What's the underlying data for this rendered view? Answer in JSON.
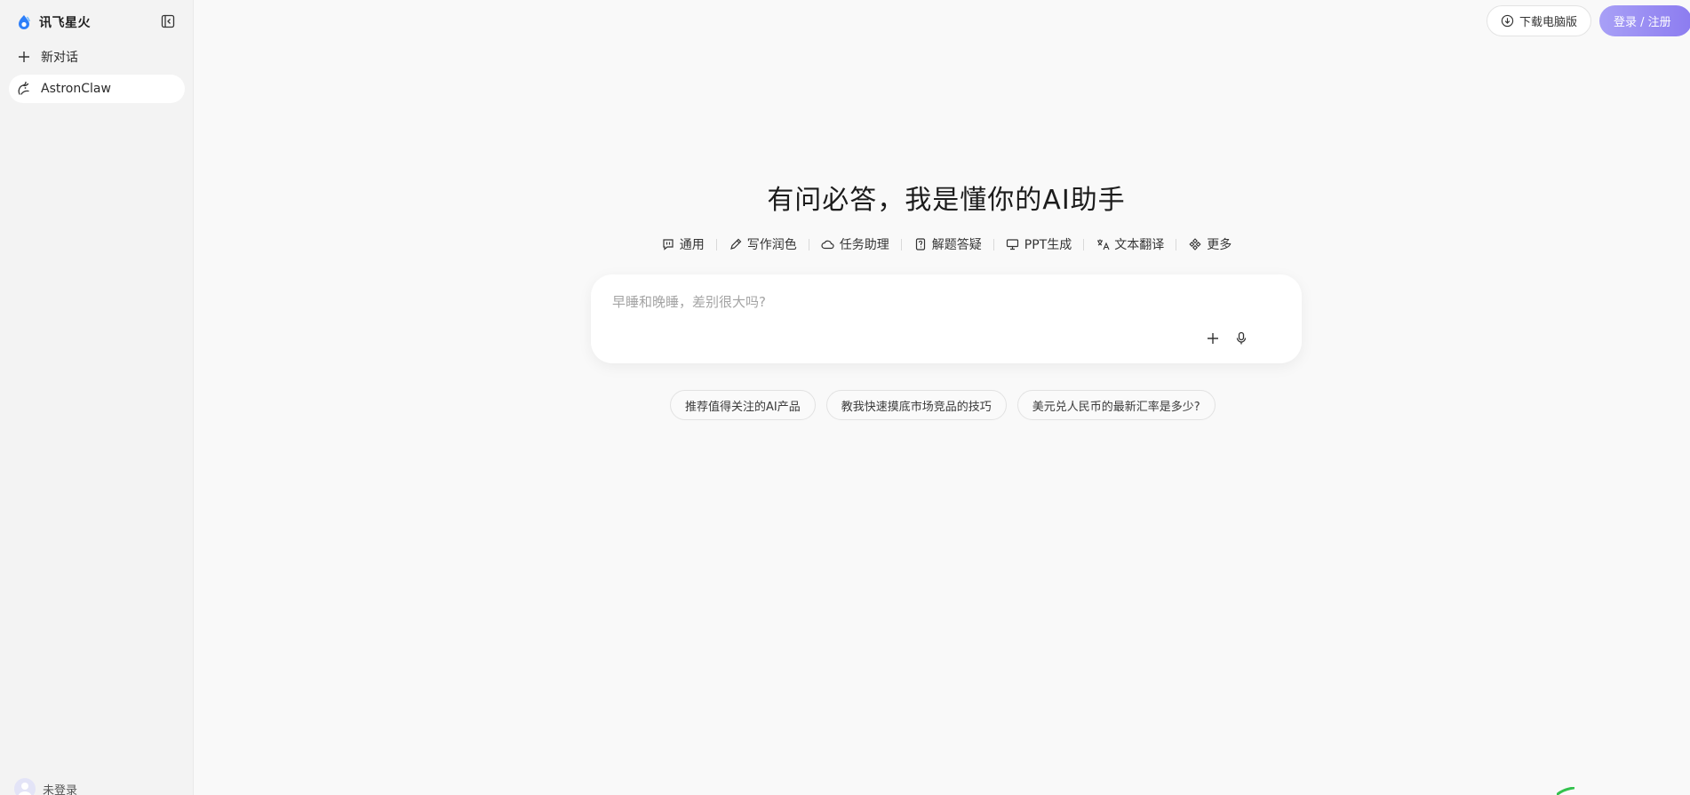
{
  "brand": {
    "name": "讯飞星火",
    "accent": "#2d7ff9"
  },
  "sidebar": {
    "collapse_icon": "sidebar-collapse-icon",
    "items": [
      {
        "label": "新对话",
        "icon": "plus-icon"
      },
      {
        "label": "AstronClaw",
        "icon": "claw-icon"
      }
    ],
    "user": {
      "label": "未登录",
      "icon": "avatar-icon"
    }
  },
  "header": {
    "download_label": "下载电脑版",
    "download_icon": "download-icon",
    "login_label": "登录 / 注册",
    "login_color": "#8c7cf0"
  },
  "main": {
    "title": "有问必答，我是懂你的AI助手",
    "modes": [
      {
        "label": "通用",
        "icon": "chat-icon"
      },
      {
        "label": "写作润色",
        "icon": "pen-icon"
      },
      {
        "label": "任务助理",
        "icon": "cloud-icon"
      },
      {
        "label": "解题答疑",
        "icon": "question-doc-icon"
      },
      {
        "label": "PPT生成",
        "icon": "presentation-icon"
      },
      {
        "label": "文本翻译",
        "icon": "translate-icon"
      },
      {
        "label": "更多",
        "icon": "more-grid-icon"
      }
    ],
    "input": {
      "placeholder": "早睡和晚睡，差别很大吗?"
    },
    "suggestions": [
      "推荐值得关注的AI产品",
      "教我快速摸底市场竞品的技巧",
      "美元兑人民币的最新汇率是多少?"
    ]
  }
}
